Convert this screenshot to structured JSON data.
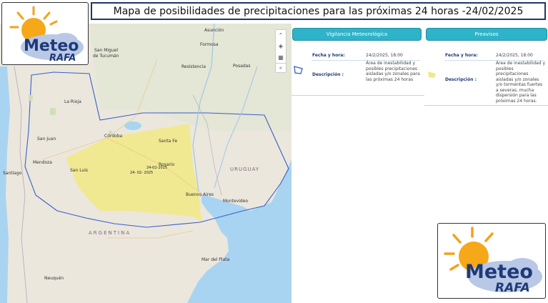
{
  "title": "Mapa de posibilidades de precipitaciones para las próximas 24 horas -24/02/2025",
  "logo": {
    "line1": "Meteo",
    "line2": "RAFA",
    "icon": "sun-cloud-icon"
  },
  "map": {
    "labels": {
      "asuncion": "Asunción",
      "formosa": "Formosa",
      "san_miguel": "San Miguel",
      "tucuman": "de Tucumán",
      "resistencia": "Resistencia",
      "posadas": "Posadas",
      "la_rioja": "La Rioja",
      "cordoba": "Córdoba",
      "santa_fe": "Santa Fe",
      "san_juan": "San Juan",
      "mendoza": "Mendoza",
      "san_luis": "San Luis",
      "santiago": "Santiago",
      "rosario": "Rosario",
      "uruguay": "URUGUAY",
      "buenos_aires": "Buenos Aires",
      "montevideo": "Montevideo",
      "argentina": "ARGENTINA",
      "mar_del_plata": "Mar del Plata",
      "neuquen": "Neuquén"
    },
    "area_dates": [
      "24-02-2025",
      "24- 02- 2025"
    ],
    "colors": {
      "water": "#a8d4f2",
      "land": "#ebe7dd",
      "alert_fill": "#f2e88a",
      "alert_border": "#3a5fc8"
    },
    "controls": {
      "expand_icon": "chevron-up-icon",
      "layers_icon": "layers-icon",
      "grid_icon": "grid-icon",
      "collapse_icon": "double-chevron-left-icon"
    },
    "control_glyphs": {
      "expand": "⌃",
      "layers": "◈",
      "grid": "▦",
      "collapse": "«"
    }
  },
  "tabs": {
    "vigilancia": "Vigilancia Meteorológica",
    "preavisos": "Preavisos"
  },
  "vigilancia": {
    "fecha_label": "Fecha y hora:",
    "fecha_value": "24/2/2025, 18:00",
    "descripcion_label": "Descripción :",
    "descripcion_value": "Área de inestabilidad y posibles precipitaciones aisladas y/o zonales para las próximas 24 horas"
  },
  "preavisos": {
    "fecha_label": "Fecha y hora:",
    "fecha_value": "24/2/2025, 18:00",
    "descripcion_label": "Descripción :",
    "descripcion_value": "Área de inestabilidad y posibles precipitaciones aisladas y/o zonales y/o tormentas fuertes a severas, mucha dispersión para las próximas 24 horas."
  }
}
